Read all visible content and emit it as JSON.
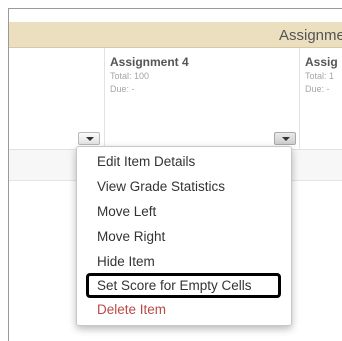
{
  "category": {
    "label": "Assignme"
  },
  "columns": [
    {
      "title": "",
      "total": "",
      "due": ""
    },
    {
      "title": "Assignment 4",
      "total": "Total: 100",
      "due": "Due: -"
    },
    {
      "title": "Assig",
      "total": "Total: 1",
      "due": "Due: -"
    }
  ],
  "menu": {
    "items": [
      {
        "label": "Edit Item Details"
      },
      {
        "label": "View Grade Statistics"
      },
      {
        "label": "Move Left"
      },
      {
        "label": "Move Right"
      },
      {
        "label": "Hide Item"
      },
      {
        "label": "Set Score for Empty Cells",
        "highlighted": true
      },
      {
        "label": "Delete Item",
        "danger": true
      }
    ]
  },
  "icons": {
    "dropdown": "chevron-down-icon"
  },
  "colors": {
    "category_bar": "#ecdfc0",
    "delete_text": "#b94a48",
    "highlight_border": "#000000"
  }
}
